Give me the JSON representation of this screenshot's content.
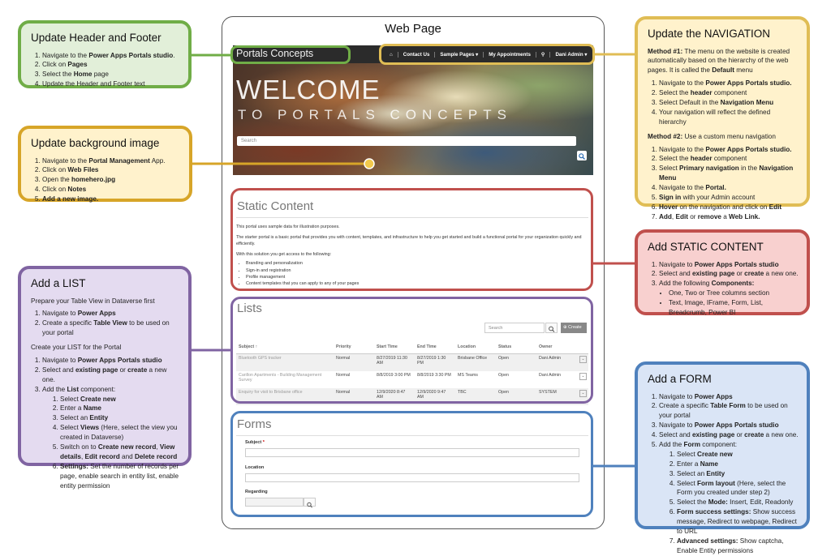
{
  "page": {
    "title": "Web Page",
    "brand": "Portals Concepts",
    "nav": [
      "Contact Us",
      "Sample Pages ▾",
      "My Appointments",
      "Dani Admin ▾"
    ],
    "hero_line1": "WELCOME",
    "hero_line2": "TO PORTALS CONCEPTS",
    "hero_search_placeholder": "Search",
    "static": {
      "title": "Static Content",
      "p1": "This portal uses sample data for illustration purposes.",
      "p2": "The starter portal is a basic portal that provides you with content, templates, and infrastructure to help you get started and build a functional portal for your organization quickly and efficiently.",
      "p3": "With this solution you get access to the following:",
      "bullets": [
        "Branding and personalization",
        "Sign-in and registration",
        "Profile management",
        "Content templates that you can apply to any of your pages"
      ]
    },
    "lists": {
      "title": "Lists",
      "search_placeholder": "Search",
      "create_label": "Create",
      "columns": [
        "Subject ↑",
        "Priority",
        "Start Time",
        "End Time",
        "Location",
        "Status",
        "Owner"
      ],
      "rows": [
        [
          "Bluetooth GPS tracker",
          "Normal",
          "8/27/2019 11:30 AM",
          "8/27/2019 1:30 PM",
          "Brisbane Office",
          "Open",
          "Dani Admin"
        ],
        [
          "Carillon Apartments - Building Management Survey",
          "Normal",
          "8/8/2019 3:00 PM",
          "8/8/2019 3:30 PM",
          "MS Teams",
          "Open",
          "Dani Admin"
        ],
        [
          "Enquiry for visit to Brisbane office",
          "Normal",
          "12/9/2020 8:47 AM",
          "12/9/2020 9:47 AM",
          "TBC",
          "Open",
          "SYSTEM"
        ]
      ]
    },
    "forms": {
      "title": "Forms",
      "subject_label": "Subject",
      "required_mark": "*",
      "location_label": "Location",
      "regarding_label": "Regarding"
    }
  },
  "callouts": {
    "header": {
      "title": "Update Header and Footer",
      "steps": [
        "Navigate to the <b>Power Apps Portals studio</b>.",
        "Click on <b>Pages</b>",
        "Select the <b>Home</b> page",
        "Update the Header and Footer text"
      ]
    },
    "background": {
      "title": "Update background image",
      "steps": [
        "Navigate to the <b>Portal Management</b> App.",
        "Click on <b>Web Files</b>",
        "Open the <b>homehero.jpg</b>",
        "Click on <b>Notes</b>",
        "<b>Add a new image.</b>"
      ]
    },
    "navigation": {
      "title": "Update the NAVIGATION",
      "method1": "<b>Method #1:</b> The menu on the website is created automatically based on the hierarchy of the web pages. It is called the <b>Default</b> menu",
      "method1_steps": [
        "Navigate to the <b>Power Apps Portals studio.</b>",
        "Select the <b>header</b> component",
        "Select Default in the <b>Navigation Menu</b>",
        "Your navigation will reflect the defined hierarchy"
      ],
      "method2": "<b>Method #2:</b> Use a custom menu navigation",
      "method2_steps": [
        "Navigate to the <b>Power Apps Portals studio.</b>",
        "Select the <b>header</b> component",
        "Select <b>Primary navigation</b> in the <b>Navigation Menu</b>",
        "Navigate to the <b>Portal.</b>",
        "<b>Sign in</b> with your Admin account",
        "<b>Hover</b> on the navigation and click on <b>Edit</b>",
        "<b>Add</b>, <b>Edit</b> or <b>remove</b> a <b>Web Link.</b>"
      ]
    },
    "static": {
      "title": "Add STATIC CONTENT",
      "steps": [
        "Navigate to <b>Power Apps Portals studio</b>",
        "Select and <b>existing page</b> or <b>create</b> a new one.",
        "Add the following <b>Components:</b>"
      ],
      "components": [
        "One, Two or Tree columns section",
        "Text, Image, IFrame, Form, List, Breadcrumb, Power BI"
      ]
    },
    "list": {
      "title": "Add a LIST",
      "prep_heading": "Prepare your Table View in Dataverse first",
      "prep_steps": [
        "Navigate to <b>Power Apps</b>",
        "Create a specific <b>Table View</b> to be used on your portal"
      ],
      "create_heading": "Create your LIST for the Portal",
      "steps": [
        "Navigate to <b>Power Apps Portals studio</b>",
        "Select and <b>existing page</b> or <b>create</b> a new one.",
        "Add the <b>List</b> component:"
      ],
      "substeps": [
        "Select <b>Create new</b>",
        "Enter a <b>Name</b>",
        "Select an <b>Entity</b>",
        "Select <b>Views</b> (Here, select the view you created in Dataverse)",
        "Switch on to <b>Create new record</b>, <b>View details</b>, <b>Edit record</b> and <b>Delete record</b>",
        "<b>Settings:</b> Set the number of records per page, enable search in entity list, enable entity permission"
      ]
    },
    "form": {
      "title": "Add a FORM",
      "steps": [
        "Navigate to <b>Power Apps</b>",
        "Create a specific <b>Table Form</b> to be used on your portal",
        "Navigate to <b>Power Apps Portals studio</b>",
        "Select and <b>existing page</b> or <b>create</b> a new one.",
        "Add the <b>Form</b> component:"
      ],
      "substeps": [
        "Select <b>Create new</b>",
        "Enter a <b>Name</b>",
        "Select an <b>Entity</b>",
        "Select <b>Form layout</b> (Here, select the Form you created under step 2)",
        "Select the <b>Mode:</b> Insert, Edit, Readonly",
        "<b>Form success settings:</b> Show success message, Redirect to webpage, Redirect to URL",
        "<b>Advanced settings:</b> Show captcha, Enable Entity permissions"
      ]
    }
  },
  "colors": {
    "green": "#70ad47",
    "yellow": "#d7a528",
    "gold": "#e0bd55",
    "red": "#c0504d",
    "purple": "#8064a2",
    "blue": "#4f81bd"
  }
}
